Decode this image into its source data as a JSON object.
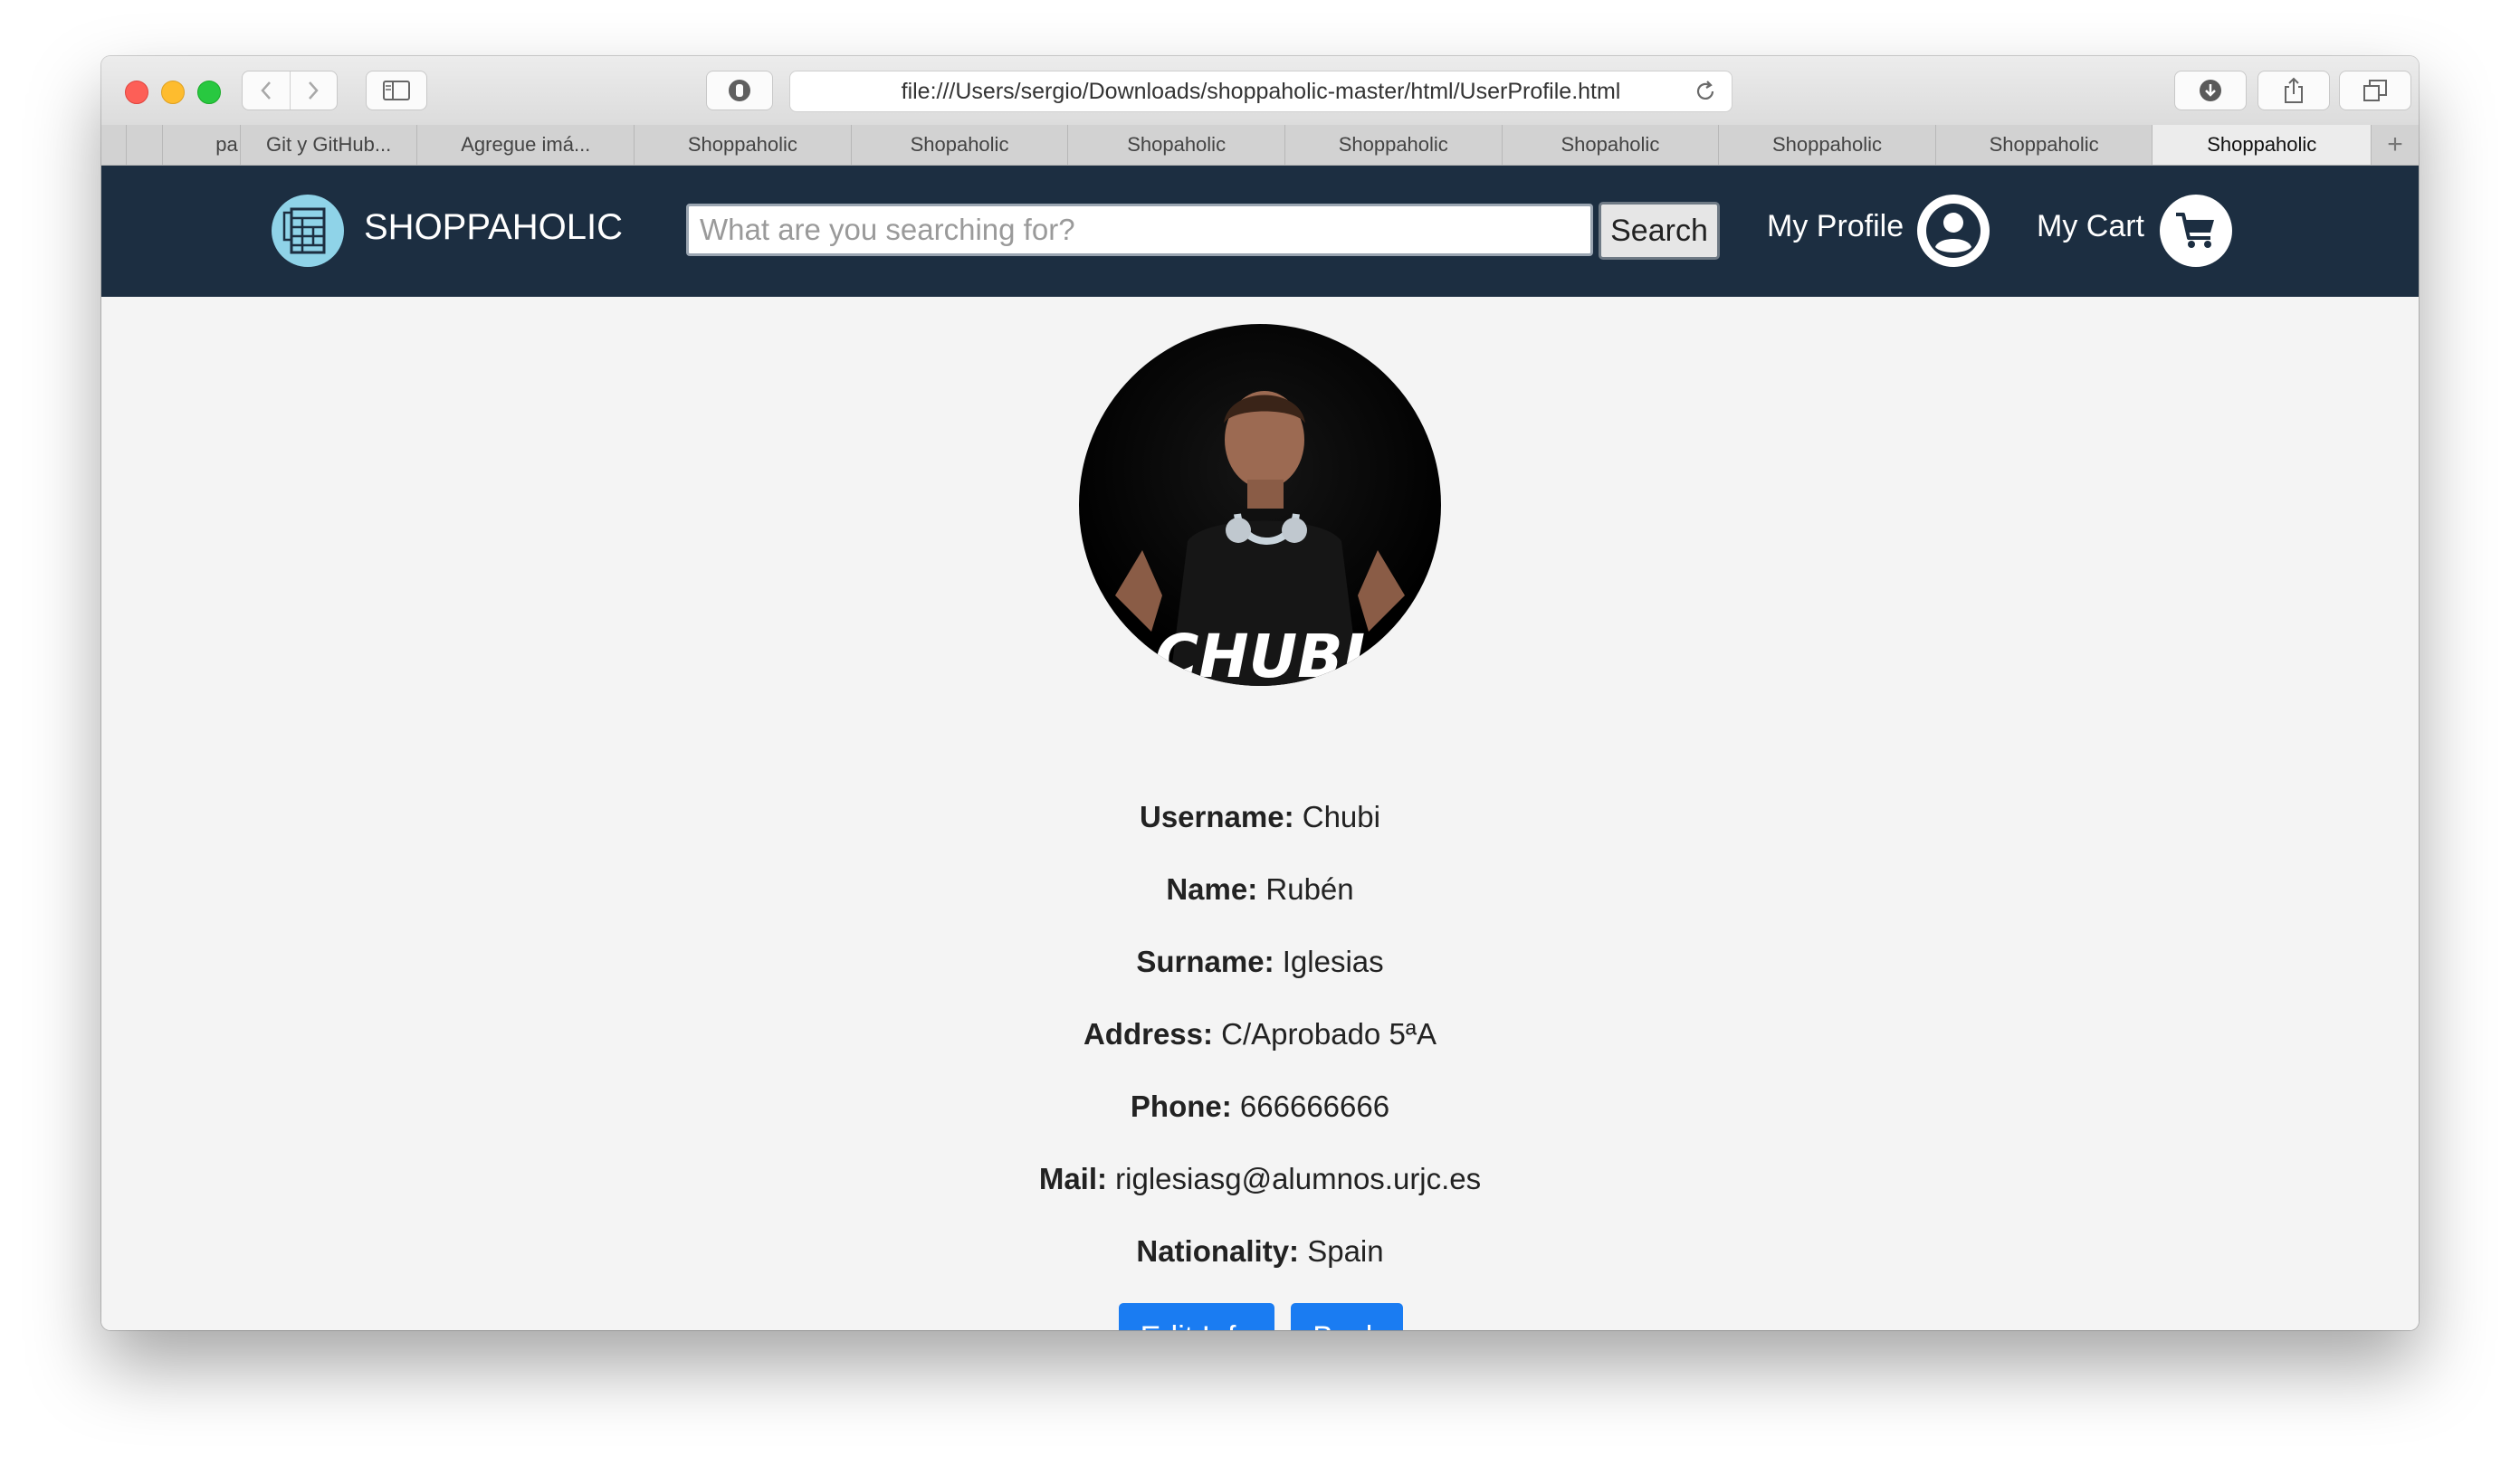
{
  "browser": {
    "url": "file:///Users/sergio/Downloads/shoppaholic-master/html/UserProfile.html",
    "tabs": [
      {
        "label": "pa"
      },
      {
        "label": "Git y GitHub..."
      },
      {
        "label": "Agregue imá..."
      },
      {
        "label": "Shoppaholic"
      },
      {
        "label": "Shopaholic"
      },
      {
        "label": "Shopaholic"
      },
      {
        "label": "Shoppaholic"
      },
      {
        "label": "Shopaholic"
      },
      {
        "label": "Shoppaholic"
      },
      {
        "label": "Shoppaholic"
      },
      {
        "label": "Shoppaholic"
      }
    ],
    "new_tab": "+"
  },
  "navbar": {
    "brand": "SHOPPAHOLIC",
    "search_placeholder": "What are you searching for?",
    "search_value": "",
    "search_button": "Search",
    "profile_label": "My Profile",
    "cart_label": "My Cart"
  },
  "profile": {
    "avatar_caption": "CHUBI",
    "fields": [
      {
        "label": "Username:",
        "value": "Chubi"
      },
      {
        "label": "Name:",
        "value": "Rubén"
      },
      {
        "label": "Surname:",
        "value": "Iglesias"
      },
      {
        "label": "Address:",
        "value": "C/Aprobado 5ªA"
      },
      {
        "label": "Phone:",
        "value": "666666666"
      },
      {
        "label": "Mail:",
        "value": "riglesiasg@alumnos.urjc.es"
      },
      {
        "label": "Nationality:",
        "value": "Spain"
      }
    ],
    "edit_button": "Edit Info",
    "back_button": "Back"
  },
  "colors": {
    "navbar": "#1c2e41",
    "primary_button": "#1a7cf2",
    "logo": "#8fd3e8",
    "page_background": "#f4f4f4"
  },
  "icons": [
    "back-arrow-icon",
    "forward-arrow-icon",
    "sidebar-icon",
    "privacy-shield-icon",
    "reload-icon",
    "download-icon",
    "share-icon",
    "tabs-overview-icon",
    "store-logo-icon",
    "user-avatar-icon",
    "shopping-cart-icon"
  ]
}
